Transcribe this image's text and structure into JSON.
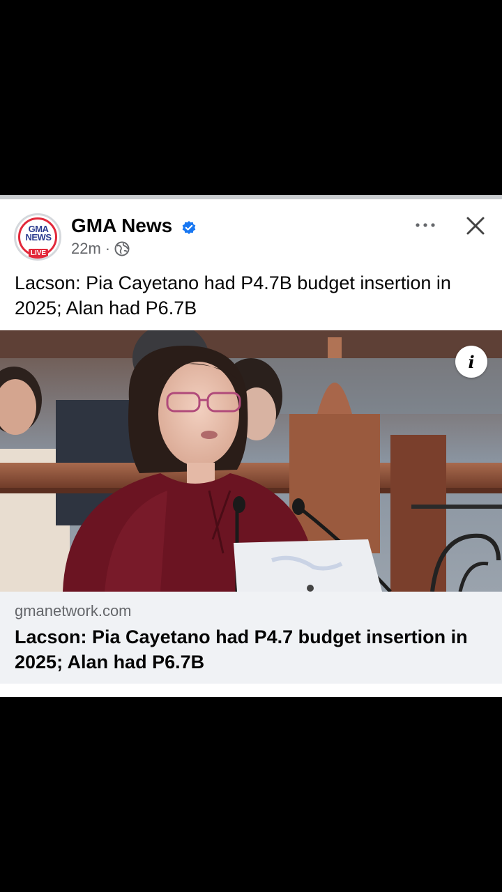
{
  "post": {
    "page_name": "GMA News",
    "time": "22m",
    "separator": "·",
    "text": "Lacson: Pia Cayetano had P4.7B budget insertion in 2025; Alan had P6.7B",
    "avatar_logo": "GMA NEWS",
    "avatar_live": "LIVE",
    "image_alt": "Senator speaking at a session hall microphone",
    "info_label": "i"
  },
  "link": {
    "domain": "gmanetwork.com",
    "title": "Lacson: Pia Cayetano had P4.7 budget insertion in 2025; Alan had P6.7B"
  },
  "icons": {
    "verified": "verified-badge-icon",
    "audience": "globe-icon",
    "more": "more-options-icon",
    "close": "close-icon"
  },
  "colors": {
    "verified_blue": "#1877f2",
    "link_bg": "#f0f2f5",
    "secondary_text": "#65676b"
  }
}
